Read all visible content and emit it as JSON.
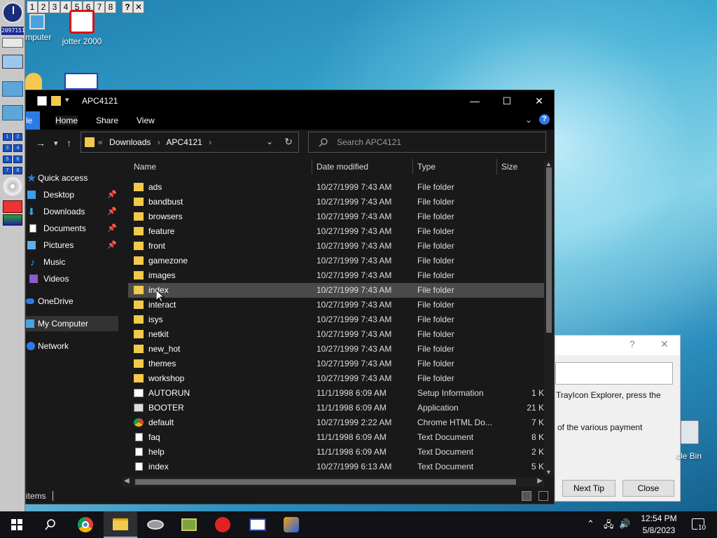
{
  "colors": {
    "accent": "#2c7be5",
    "folder": "#f2c94c",
    "window_bg": "#191919",
    "taskbar_bg": "#101215"
  },
  "legacy_toolbar": {
    "counter": "2097151",
    "buttons": [
      "1",
      "2",
      "3",
      "4",
      "5",
      "6",
      "7",
      "8"
    ],
    "help": "?",
    "close": "✕"
  },
  "desktop_icons": {
    "computer": "mputer",
    "jotter": "jotter 2000",
    "recycle": "cle Bin",
    "recycle_partial_left": "le"
  },
  "window": {
    "title": "APC4121",
    "controls": {
      "minimize": "—",
      "maximize": "☐",
      "close": "✕"
    },
    "ribbon_tabs": [
      "Home",
      "Share",
      "View"
    ],
    "breadcrumb": {
      "prefix": "«",
      "parts": [
        "Downloads",
        "APC4121"
      ],
      "sep": "›"
    },
    "search_placeholder": "Search APC4121",
    "nav": {
      "quick_access": "Quick access",
      "items": [
        {
          "label": "Desktop",
          "icon": "desktop-icon",
          "pinned": true
        },
        {
          "label": "Downloads",
          "icon": "download-icon",
          "pinned": true
        },
        {
          "label": "Documents",
          "icon": "documents-icon",
          "pinned": true
        },
        {
          "label": "Pictures",
          "icon": "pictures-icon",
          "pinned": true
        },
        {
          "label": "Music",
          "icon": "music-icon",
          "pinned": false
        },
        {
          "label": "Videos",
          "icon": "videos-icon",
          "pinned": false
        }
      ],
      "onedrive": "OneDrive",
      "mycomputer": "My Computer",
      "network": "Network"
    },
    "columns": {
      "name": "Name",
      "date": "Date modified",
      "type": "Type",
      "size": "Size"
    },
    "files": [
      {
        "name": "ads",
        "date": "10/27/1999 7:43 AM",
        "type": "File folder",
        "size": "",
        "icon": "folder-icon"
      },
      {
        "name": "bandbust",
        "date": "10/27/1999 7:43 AM",
        "type": "File folder",
        "size": "",
        "icon": "folder-icon"
      },
      {
        "name": "browsers",
        "date": "10/27/1999 7:43 AM",
        "type": "File folder",
        "size": "",
        "icon": "folder-icon"
      },
      {
        "name": "feature",
        "date": "10/27/1999 7:43 AM",
        "type": "File folder",
        "size": "",
        "icon": "folder-icon"
      },
      {
        "name": "front",
        "date": "10/27/1999 7:43 AM",
        "type": "File folder",
        "size": "",
        "icon": "folder-icon"
      },
      {
        "name": "gamezone",
        "date": "10/27/1999 7:43 AM",
        "type": "File folder",
        "size": "",
        "icon": "folder-icon"
      },
      {
        "name": "images",
        "date": "10/27/1999 7:43 AM",
        "type": "File folder",
        "size": "",
        "icon": "folder-icon"
      },
      {
        "name": "index",
        "date": "10/27/1999 7:43 AM",
        "type": "File folder",
        "size": "",
        "icon": "folder-icon"
      },
      {
        "name": "interact",
        "date": "10/27/1999 7:43 AM",
        "type": "File folder",
        "size": "",
        "icon": "folder-icon"
      },
      {
        "name": "isys",
        "date": "10/27/1999 7:43 AM",
        "type": "File folder",
        "size": "",
        "icon": "folder-icon"
      },
      {
        "name": "netkit",
        "date": "10/27/1999 7:43 AM",
        "type": "File folder",
        "size": "",
        "icon": "folder-icon"
      },
      {
        "name": "new_hot",
        "date": "10/27/1999 7:43 AM",
        "type": "File folder",
        "size": "",
        "icon": "folder-icon"
      },
      {
        "name": "themes",
        "date": "10/27/1999 7:43 AM",
        "type": "File folder",
        "size": "",
        "icon": "folder-icon"
      },
      {
        "name": "workshop",
        "date": "10/27/1999 7:43 AM",
        "type": "File folder",
        "size": "",
        "icon": "folder-icon"
      },
      {
        "name": "AUTORUN",
        "date": "11/1/1998 6:09 AM",
        "type": "Setup Information",
        "size": "1 K",
        "icon": "settings-file-icon"
      },
      {
        "name": "BOOTER",
        "date": "11/1/1998 6:09 AM",
        "type": "Application",
        "size": "21 K",
        "icon": "application-icon"
      },
      {
        "name": "default",
        "date": "10/27/1999 2:22 AM",
        "type": "Chrome HTML Do...",
        "size": "7 K",
        "icon": "chrome-icon"
      },
      {
        "name": "faq",
        "date": "11/1/1998 6:09 AM",
        "type": "Text Document",
        "size": "8 K",
        "icon": "text-document-icon"
      },
      {
        "name": "help",
        "date": "11/1/1998 6:09 AM",
        "type": "Text Document",
        "size": "2 K",
        "icon": "text-document-icon"
      },
      {
        "name": "index",
        "date": "10/27/1999 6:13 AM",
        "type": "Text Document",
        "size": "5 K",
        "icon": "text-document-icon"
      }
    ],
    "status_text": "items"
  },
  "tip_dialog": {
    "help": "?",
    "close": "✕",
    "text_line1": "TrayIcon Explorer, press the",
    "text_line2": "of the various payment",
    "next_tip": "Next Tip",
    "close_button": "Close"
  },
  "taskbar": {
    "time": "12:54 PM",
    "date": "5/8/2023",
    "notification_count": "10"
  }
}
